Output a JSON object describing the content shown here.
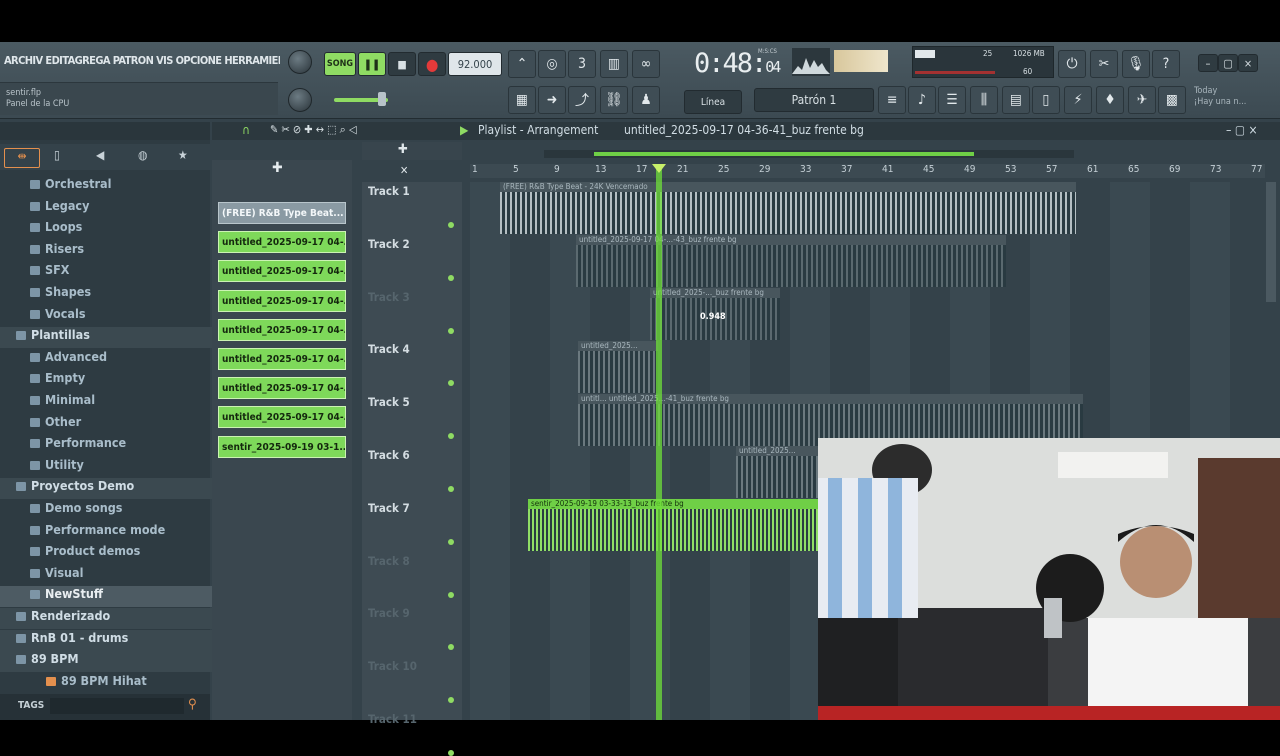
{
  "menu": {
    "text": "ARCHIV EDITAGREGA PATRON VIS OPCIONE HERRAMIENTA"
  },
  "hint": {
    "line1": "sentir.flp",
    "line2": "Panel de la CPU"
  },
  "transport": {
    "mode_label": "SONG",
    "play": "❚❚",
    "stop": "■",
    "record": "●",
    "tempo": "92.000"
  },
  "time": {
    "main": "0:48:",
    "sub": "04",
    "unit": "M:S:CS"
  },
  "monitor": {
    "val1": "25",
    "val2": "1026 MB",
    "val3": "60"
  },
  "snap": "Línea",
  "pattern": "Patrón 1",
  "news": {
    "line1": "Today",
    "line2": "¡Hay una n..."
  },
  "playlist": {
    "title": "Playlist - Arrangement",
    "file": "untitled_2025-09-17 04-36-41_buz frente bg"
  },
  "ruler": [
    "1",
    "5",
    "9",
    "13",
    "17",
    "21",
    "25",
    "29",
    "33",
    "37",
    "41",
    "45",
    "49",
    "53",
    "57",
    "61",
    "65",
    "69",
    "73",
    "77"
  ],
  "browser": {
    "items": [
      {
        "label": "Orchestral",
        "type": "folder"
      },
      {
        "label": "Legacy",
        "type": "folder"
      },
      {
        "label": "Loops",
        "type": "folder"
      },
      {
        "label": "Risers",
        "type": "folder"
      },
      {
        "label": "SFX",
        "type": "folder"
      },
      {
        "label": "Shapes",
        "type": "folder"
      },
      {
        "label": "Vocals",
        "type": "folder"
      },
      {
        "label": "Plantillas",
        "type": "section"
      },
      {
        "label": "Advanced",
        "type": "folder"
      },
      {
        "label": "Empty",
        "type": "folder"
      },
      {
        "label": "Minimal",
        "type": "folder"
      },
      {
        "label": "Other",
        "type": "folder"
      },
      {
        "label": "Performance",
        "type": "folder"
      },
      {
        "label": "Utility",
        "type": "folder"
      },
      {
        "label": "Proyectos Demo",
        "type": "section"
      },
      {
        "label": "Demo songs",
        "type": "folder"
      },
      {
        "label": "Performance mode",
        "type": "folder"
      },
      {
        "label": "Product demos",
        "type": "folder"
      },
      {
        "label": "Visual",
        "type": "folder"
      },
      {
        "label": "NewStuff",
        "type": "selected"
      },
      {
        "label": "Renderizado",
        "type": "section"
      },
      {
        "label": "RnB 01 - drums",
        "type": "section"
      },
      {
        "label": "89 BPM",
        "type": "section"
      },
      {
        "label": "89 BPM Hihat",
        "type": "file"
      }
    ],
    "tags": "TAGS"
  },
  "picker": [
    "(FREE) R&B Type Beat...",
    "untitled_2025-09-17 04-...",
    "untitled_2025-09-17 04-...",
    "untitled_2025-09-17 04-...",
    "untitled_2025-09-17 04-...",
    "untitled_2025-09-17 04-...",
    "untitled_2025-09-17 04-...",
    "untitled_2025-09-17 04-...",
    "sentir_2025-09-19 03-1..."
  ],
  "tracks": [
    {
      "name": "Track 1",
      "dim": false
    },
    {
      "name": "Track 2",
      "dim": false
    },
    {
      "name": "Track 3",
      "dim": true
    },
    {
      "name": "Track 4",
      "dim": false
    },
    {
      "name": "Track 5",
      "dim": false
    },
    {
      "name": "Track 6",
      "dim": false
    },
    {
      "name": "Track 7",
      "dim": false
    },
    {
      "name": "Track 8",
      "dim": true
    },
    {
      "name": "Track 9",
      "dim": true
    },
    {
      "name": "Track 10",
      "dim": true
    },
    {
      "name": "Track 11",
      "dim": true
    }
  ],
  "clips": {
    "c1": "(FREE) R&B Type Beat - 24K Vencemado",
    "c2": "untitled_2025-09-17 04-...-43_buz frente bg",
    "c3": "untitled_2025-..._buz frente bg",
    "c3val": "0.948",
    "c4": "untitled_2025...",
    "c5": "untitl...  untitled_2025...-41_buz frente bg",
    "c6": "untitled_2025...",
    "c7": "sentir_2025-09-19 03-33-13_buz frente bg"
  },
  "colors": {
    "accent_green": "#8fdb63",
    "bg": "#34424a"
  }
}
